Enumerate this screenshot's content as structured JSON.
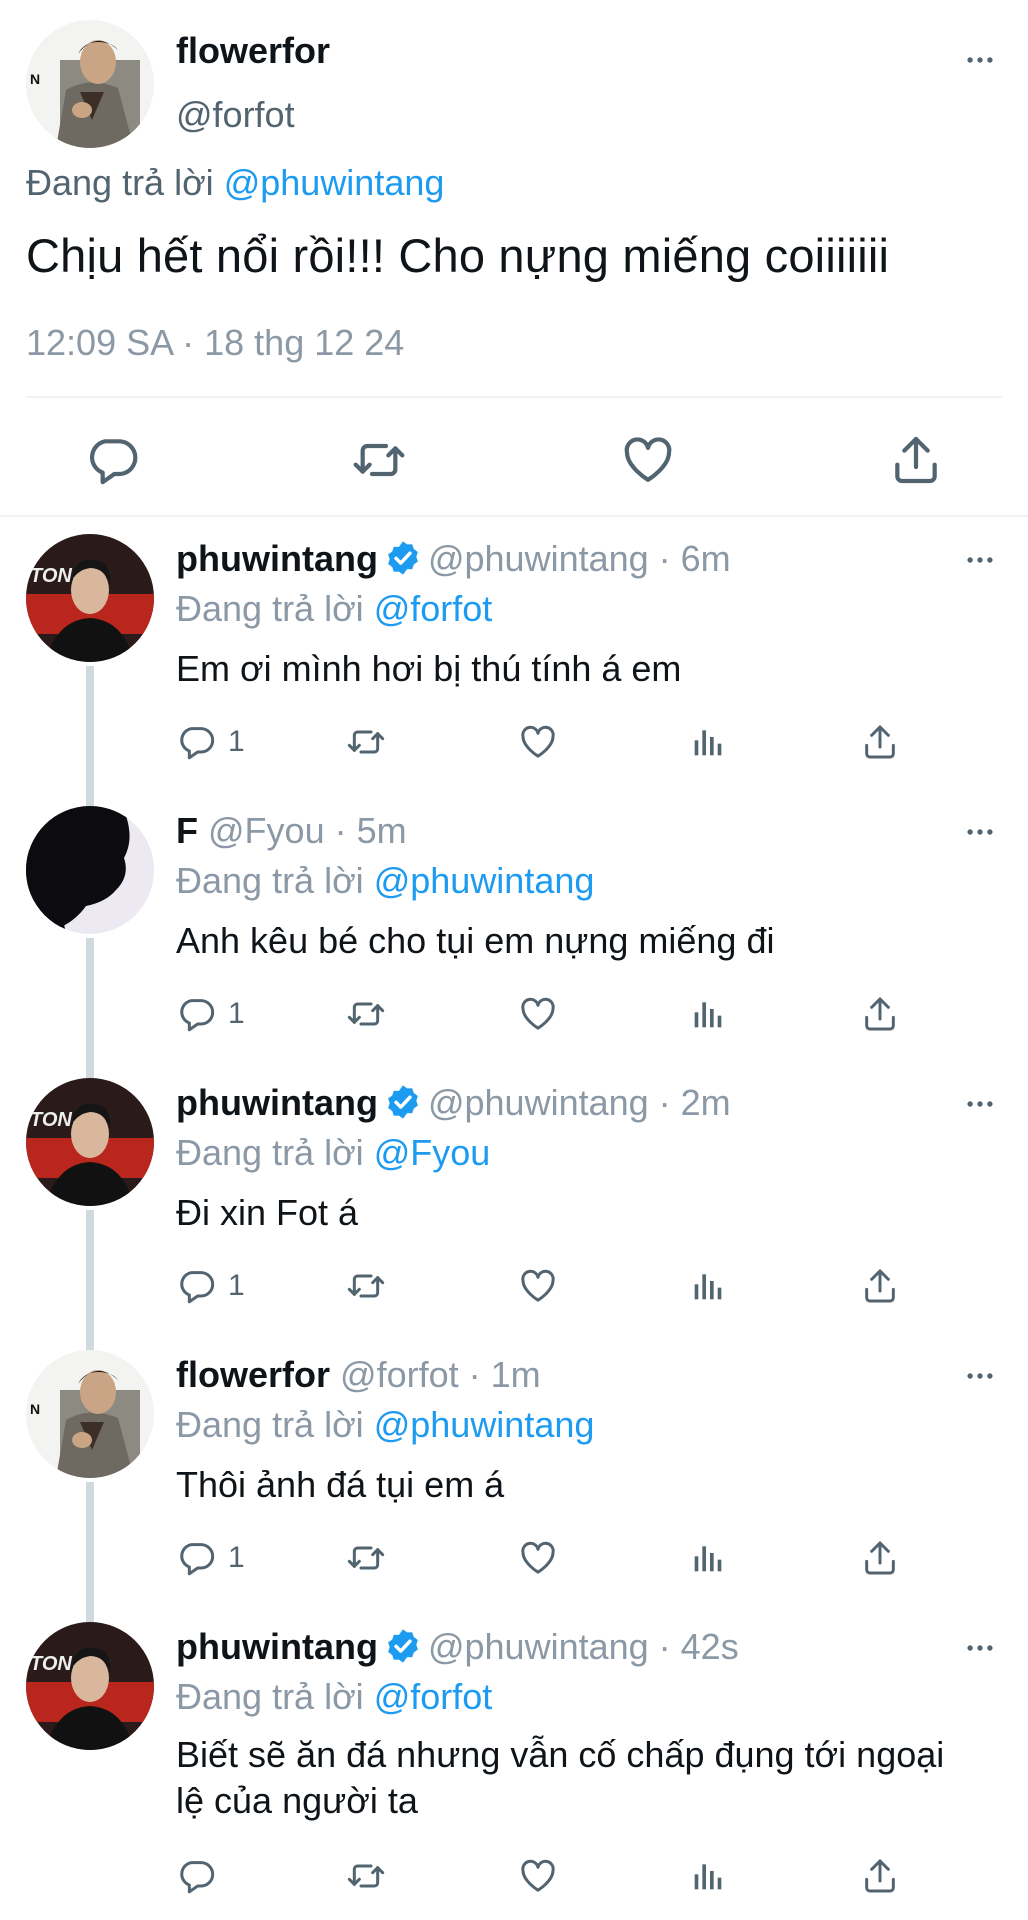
{
  "main_tweet": {
    "name": "flowerfor",
    "handle": "@forfot",
    "replying_prefix": "Đang trả lời",
    "replying_to": "@phuwintang",
    "text": "Chịu hết nổi rồi!!! Cho nựng miếng coiiiiiii",
    "timestamp": "12:09 SA · 18 thg 12 24"
  },
  "replies": [
    {
      "name": "phuwintang",
      "verified": true,
      "handle_meta": "@phuwintang · 6m",
      "replying_prefix": "Đang trả lời",
      "replying_to": "@forfot",
      "text": "Em ơi mình hơi bị thú tính á em",
      "reply_count": "1"
    },
    {
      "name": "F",
      "verified": false,
      "handle_meta": "@Fyou · 5m",
      "replying_prefix": "Đang trả lời",
      "replying_to": "@phuwintang",
      "text": "Anh kêu bé cho tụi em nựng miếng đi",
      "reply_count": "1"
    },
    {
      "name": "phuwintang",
      "verified": true,
      "handle_meta": "@phuwintang · 2m",
      "replying_prefix": "Đang trả lời",
      "replying_to": "@Fyou",
      "text": "Đi xin Fot á",
      "reply_count": "1"
    },
    {
      "name": "flowerfor",
      "verified": false,
      "handle_meta": "@forfot · 1m",
      "replying_prefix": "Đang trả lời",
      "replying_to": "@phuwintang",
      "text": "Thôi ảnh đá tụi em á",
      "reply_count": "1"
    },
    {
      "name": "phuwintang",
      "verified": true,
      "handle_meta": "@phuwintang · 42s",
      "replying_prefix": "Đang trả lời",
      "replying_to": "@forfot",
      "text": "Biết sẽ ăn đá nhưng vẫn cố chấp đụng tới ngoại lệ của người ta",
      "reply_count": ""
    }
  ],
  "avatar_badges": {
    "flowerfor": "N",
    "phuwintang": "TONCR"
  },
  "colors": {
    "link": "#1d9bf0",
    "verified": "#1d9bf0",
    "muted": "#8b98a5",
    "text": "#0f1419"
  },
  "icons": [
    "reply-icon",
    "retweet-icon",
    "like-icon",
    "share-icon",
    "analytics-icon",
    "more-icon",
    "verified-badge-icon"
  ]
}
